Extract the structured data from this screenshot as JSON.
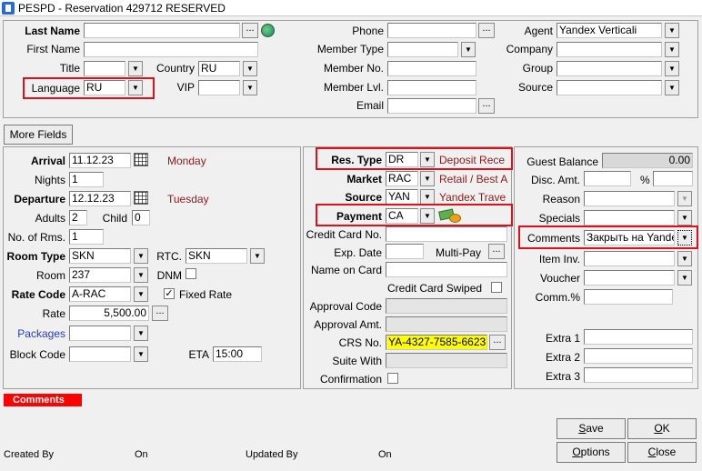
{
  "window": {
    "title": "PESPD - Reservation 429712  RESERVED"
  },
  "guest": {
    "last_name_label": "Last Name",
    "first_name_label": "First Name",
    "title_label": "Title",
    "country_label": "Country",
    "country_value": "RU",
    "language_label": "Language",
    "language_value": "RU",
    "vip_label": "VIP",
    "phone_label": "Phone",
    "member_type_label": "Member Type",
    "member_no_label": "Member No.",
    "member_lvl_label": "Member Lvl.",
    "email_label": "Email",
    "agent_label": "Agent",
    "agent_value": "Yandex Verticali",
    "company_label": "Company",
    "group_label": "Group",
    "source_label": "Source"
  },
  "more_fields_label": "More Fields",
  "stay": {
    "arrival_label": "Arrival",
    "arrival_value": "11.12.23",
    "arrival_day": "Monday",
    "nights_label": "Nights",
    "nights_value": "1",
    "departure_label": "Departure",
    "departure_value": "12.12.23",
    "departure_day": "Tuesday",
    "adults_label": "Adults",
    "adults_value": "2",
    "child_label": "Child",
    "child_value": "0",
    "rooms_label": "No. of Rms.",
    "rooms_value": "1",
    "room_type_label": "Room Type",
    "room_type_value": "SKN",
    "rtc_label": "RTC.",
    "rtc_value": "SKN",
    "room_label": "Room",
    "room_value": "237",
    "dnm_label": "DNM",
    "rate_code_label": "Rate Code",
    "rate_code_value": "A-RAC",
    "fixed_rate_label": "Fixed Rate",
    "rate_label": "Rate",
    "rate_value": "5,500.00",
    "packages_label": "Packages",
    "block_code_label": "Block Code",
    "eta_label": "ETA",
    "eta_value": "15:00"
  },
  "payment": {
    "res_type_label": "Res. Type",
    "res_type_value": "DR",
    "res_type_desc": "Deposit Rece",
    "market_label": "Market",
    "market_value": "RAC",
    "market_desc": "Retail / Best A",
    "source_label": "Source",
    "source_value": "YAN",
    "source_desc": "Yandex Trave",
    "payment_label": "Payment",
    "payment_value": "CA",
    "cc_no_label": "Credit Card No.",
    "exp_date_label": "Exp. Date",
    "multi_pay_label": "Multi-Pay",
    "name_on_card_label": "Name on Card",
    "cc_swiped_label": "Credit Card Swiped",
    "approval_code_label": "Approval Code",
    "approval_amt_label": "Approval Amt.",
    "crs_no_label": "CRS No.",
    "crs_no_value": "YA-4327-7585-6623",
    "suite_with_label": "Suite With",
    "confirmation_label": "Confirmation"
  },
  "misc": {
    "guest_balance_label": "Guest Balance",
    "guest_balance_value": "0.00",
    "disc_amt_label": "Disc. Amt.",
    "percent_label": "%",
    "reason_label": "Reason",
    "specials_label": "Specials",
    "comments_label": "Comments",
    "comments_value": "Закрыть на Yandex",
    "item_inv_label": "Item Inv.",
    "voucher_label": "Voucher",
    "comm_pct_label": "Comm.%",
    "extra1_label": "Extra 1",
    "extra2_label": "Extra 2",
    "extra3_label": "Extra 3"
  },
  "comments_tab_label": "Comments",
  "footer": {
    "created_by_label": "Created By",
    "created_on_label": "On",
    "updated_by_label": "Updated By",
    "updated_on_label": "On"
  },
  "buttons": {
    "save_key": "S",
    "save_rest": "ave",
    "ok_key": "O",
    "ok_rest": "K",
    "options_key": "O",
    "options_rest": "ptions",
    "close_key": "C",
    "close_rest": "lose"
  },
  "colors": {
    "highlight_border": "#e0101a",
    "crs_background": "#ffff00",
    "comments_tab": "#ff0000"
  }
}
